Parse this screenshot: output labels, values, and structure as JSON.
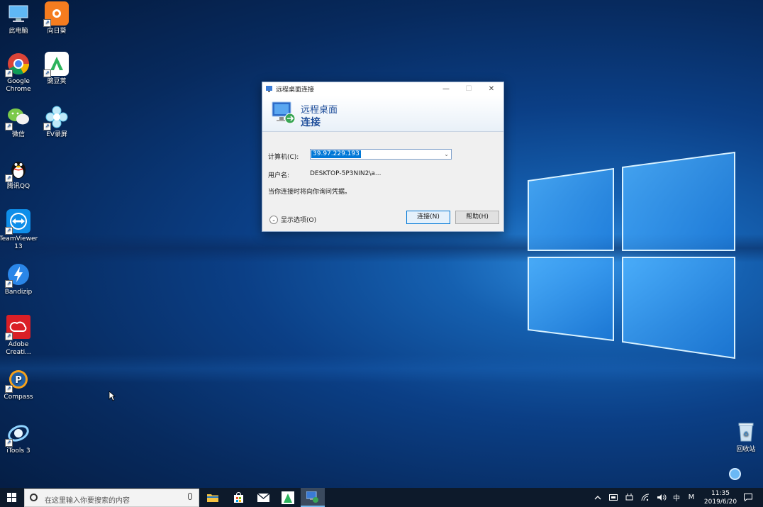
{
  "desktop": {
    "icons": [
      {
        "label": "此电脑"
      },
      {
        "label": "向日葵"
      },
      {
        "label": "Google Chrome"
      },
      {
        "label": "豌豆荚"
      },
      {
        "label": "微信"
      },
      {
        "label": "EV录屏"
      },
      {
        "label": "腾讯QQ"
      },
      {
        "label": "TeamViewer 13"
      },
      {
        "label": "Bandizip"
      },
      {
        "label": "Adobe Creati..."
      },
      {
        "label": "Compass"
      },
      {
        "label": "iTools 3"
      },
      {
        "label": "回收站"
      }
    ]
  },
  "dialog": {
    "title": "远程桌面连接",
    "banner_line1": "远程桌面",
    "banner_line2": "连接",
    "computer_label": "计算机(C):",
    "computer_value": "39.97.229.193",
    "username_label": "用户名:",
    "username_value": "DESKTOP-5P3NIN2\\a...",
    "info_text": "当你连接时将向你询问凭据。",
    "show_options": "显示选项(O)",
    "connect_button": "连接(N)",
    "help_button": "帮助(H)",
    "minimize": "—",
    "maximize": "☐",
    "close": "✕"
  },
  "taskbar": {
    "search_placeholder": "在这里输入你要搜索的内容",
    "ime_label": "中",
    "ime_mode": "M",
    "time": "11:35",
    "date": "2019/6/20"
  },
  "colors": {
    "accent": "#0078d7",
    "taskbar": "#0d1a2b",
    "dialog_title": "#1f4e9a"
  }
}
